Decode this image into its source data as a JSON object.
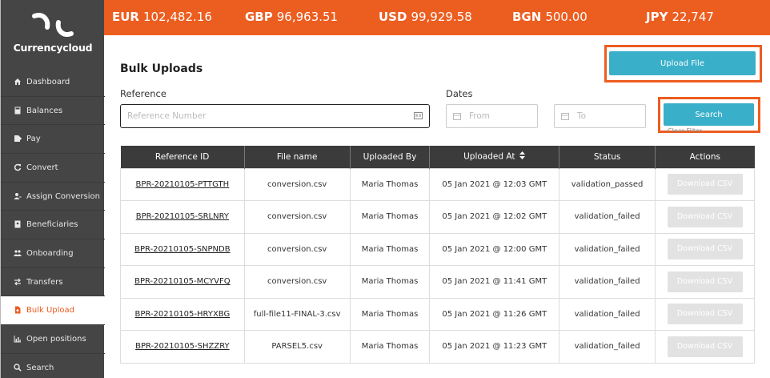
{
  "brand": {
    "name": "Currencycloud"
  },
  "balances": [
    {
      "code": "EUR",
      "amount": "102,482.16"
    },
    {
      "code": "GBP",
      "amount": "96,963.51"
    },
    {
      "code": "USD",
      "amount": "99,929.58"
    },
    {
      "code": "BGN",
      "amount": "500.00"
    },
    {
      "code": "JPY",
      "amount": "22,747"
    }
  ],
  "sidebar": {
    "items": [
      {
        "label": "Dashboard",
        "icon": "home-icon"
      },
      {
        "label": "Balances",
        "icon": "calculator-icon"
      },
      {
        "label": "Pay",
        "icon": "pay-icon"
      },
      {
        "label": "Convert",
        "icon": "refresh-icon"
      },
      {
        "label": "Assign Conversion",
        "icon": "user-assign-icon"
      },
      {
        "label": "Beneficiaries",
        "icon": "address-card-icon"
      },
      {
        "label": "Onboarding",
        "icon": "users-icon"
      },
      {
        "label": "Transfers",
        "icon": "exchange-icon"
      },
      {
        "label": "Bulk Upload",
        "icon": "file-upload-icon",
        "active": true
      },
      {
        "label": "Open positions",
        "icon": "chart-icon"
      },
      {
        "label": "Search",
        "icon": "search-icon"
      }
    ]
  },
  "page": {
    "title": "Bulk Uploads",
    "upload_label": "Upload File",
    "search_label": "Search",
    "clear_filter_label": "Clear Filter"
  },
  "filters": {
    "reference_label": "Reference",
    "reference_placeholder": "Reference Number",
    "dates_label": "Dates",
    "from_placeholder": "From",
    "to_placeholder": "To"
  },
  "table": {
    "columns": [
      "Reference ID",
      "File name",
      "Uploaded By",
      "Uploaded At",
      "Status",
      "Actions"
    ],
    "rows": [
      {
        "ref": "BPR-20210105-PTTGTH",
        "file": "conversion.csv",
        "by": "Maria Thomas",
        "at": "05 Jan 2021 @ 12:03 GMT",
        "status": "validation_passed",
        "action": "Download CSV"
      },
      {
        "ref": "BPR-20210105-SRLNRY",
        "file": "conversion.csv",
        "by": "Maria Thomas",
        "at": "05 Jan 2021 @ 12:02 GMT",
        "status": "validation_failed",
        "action": "Download CSV"
      },
      {
        "ref": "BPR-20210105-SNPNDB",
        "file": "conversion.csv",
        "by": "Maria Thomas",
        "at": "05 Jan 2021 @ 12:00 GMT",
        "status": "validation_failed",
        "action": "Download CSV"
      },
      {
        "ref": "BPR-20210105-MCYVFQ",
        "file": "conversion.csv",
        "by": "Maria Thomas",
        "at": "05 Jan 2021 @ 11:41 GMT",
        "status": "validation_failed",
        "action": "Download CSV"
      },
      {
        "ref": "BPR-20210105-HRYXBG",
        "file": "full-file11-FINAL-3.csv",
        "by": "Maria Thomas",
        "at": "05 Jan 2021 @ 11:26 GMT",
        "status": "validation_failed",
        "action": "Download CSV"
      },
      {
        "ref": "BPR-20210105-SHZZRY",
        "file": "PARSEL5.csv",
        "by": "Maria Thomas",
        "at": "05 Jan 2021 @ 11:23 GMT",
        "status": "validation_failed",
        "action": "Download CSV"
      }
    ]
  },
  "colors": {
    "accent": "#ec5d20",
    "button": "#3aafc9",
    "sidebar": "#454545",
    "table_header": "#3b3b3b"
  }
}
